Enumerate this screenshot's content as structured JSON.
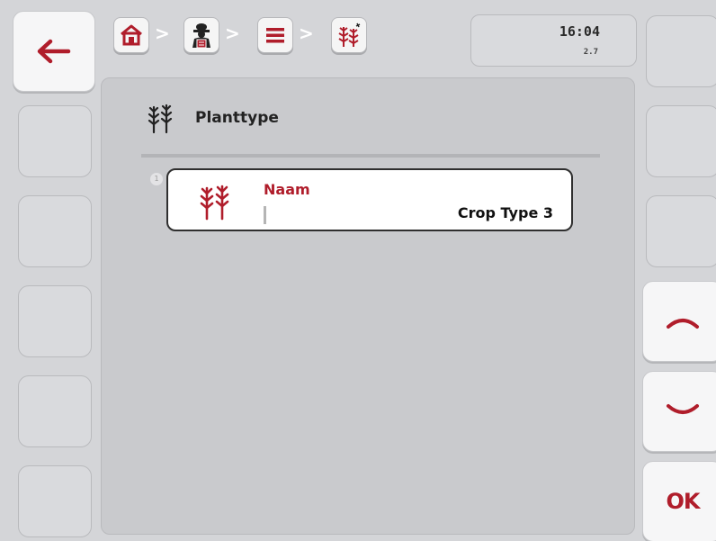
{
  "header": {
    "breadcrumb_sep": ">",
    "clock": {
      "time": "16:04",
      "sub": "2.7"
    },
    "icons": [
      "home-icon",
      "operator-icon",
      "list-icon",
      "crop-type-icon"
    ]
  },
  "panel": {
    "title": "Planttype",
    "items": [
      {
        "index": "1",
        "label": "Naam",
        "value": "Crop Type 3"
      }
    ]
  },
  "softkeys": {
    "ok_label": "OK"
  },
  "colors": {
    "accent_red": "#b01d2b",
    "background": "#d4d5d8",
    "panel": "#c9cacd"
  }
}
